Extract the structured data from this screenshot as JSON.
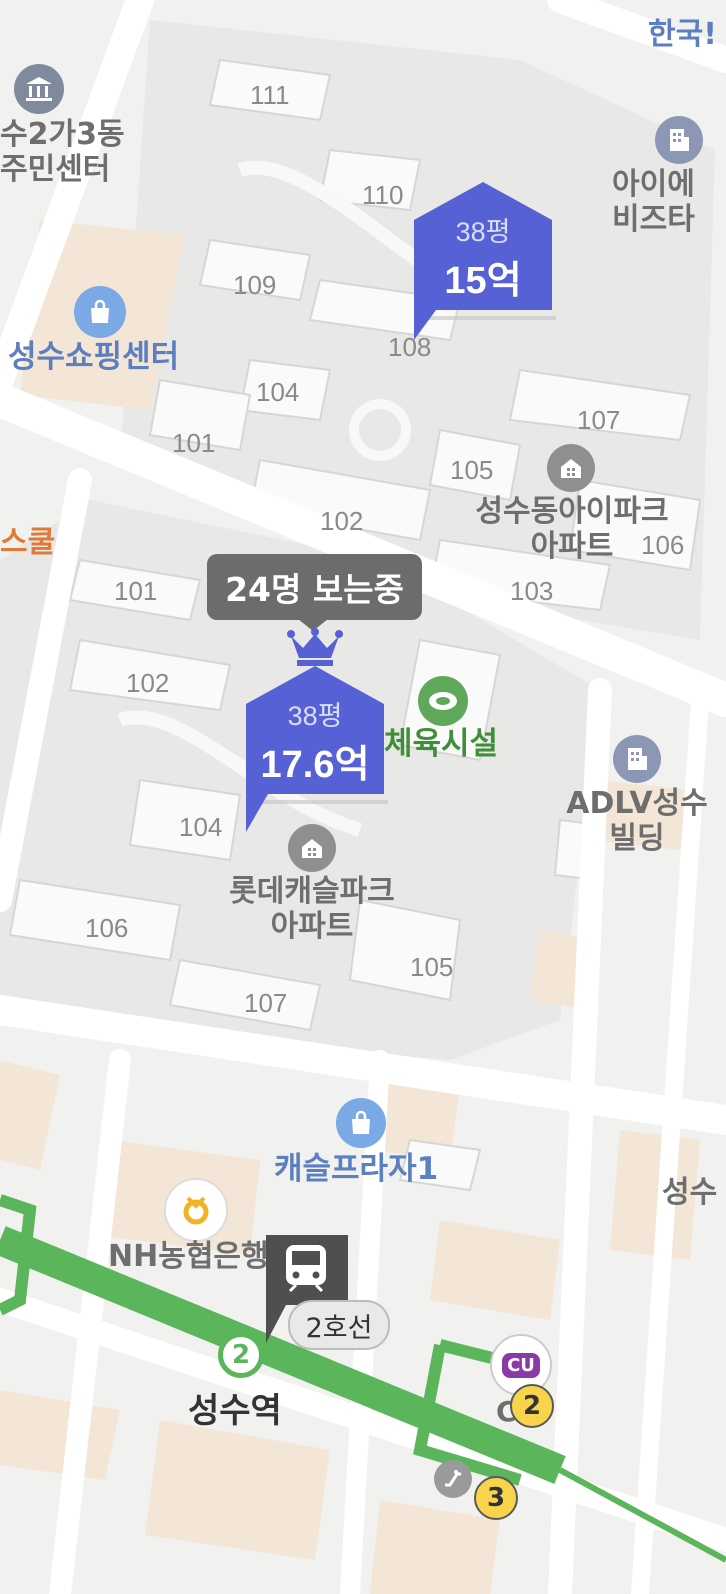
{
  "building_numbers": [
    "111",
    "110",
    "109",
    "108",
    "104",
    "101",
    "107",
    "105",
    "102",
    "106",
    "103",
    "101",
    "102",
    "104",
    "106",
    "107",
    "105"
  ],
  "poi": {
    "community_center": "수2가3동\n주민센터",
    "korea": "한국!",
    "aihaeri": "아이에\n비즈타",
    "shopping_center": "성수쇼핑센터",
    "iparkan": "성수동아이파크\n아파트",
    "school": "스쿨",
    "sports": "체육시설",
    "adlv": "ADLV성수\n빌딩",
    "lotte": "롯데캐슬파크\n아파트",
    "castle_plaza": "캐슬프라자1",
    "nh_bank": "NH농협은행",
    "seongsu_right": "성수",
    "station_name": "성수역",
    "cu": "CU",
    "cu_below": "C"
  },
  "markers": [
    {
      "area": "38평",
      "price": "15억"
    },
    {
      "area": "38평",
      "price": "17.6억"
    }
  ],
  "viewers_bubble": "24명 보는중",
  "subway": {
    "line_label": "2호선",
    "line_number": "2",
    "exit_2": "2",
    "exit_3": "3",
    "line_color": "#5bb55a"
  },
  "colors": {
    "marker": "#5761d6",
    "poi_blue": "#5b7fc0"
  }
}
